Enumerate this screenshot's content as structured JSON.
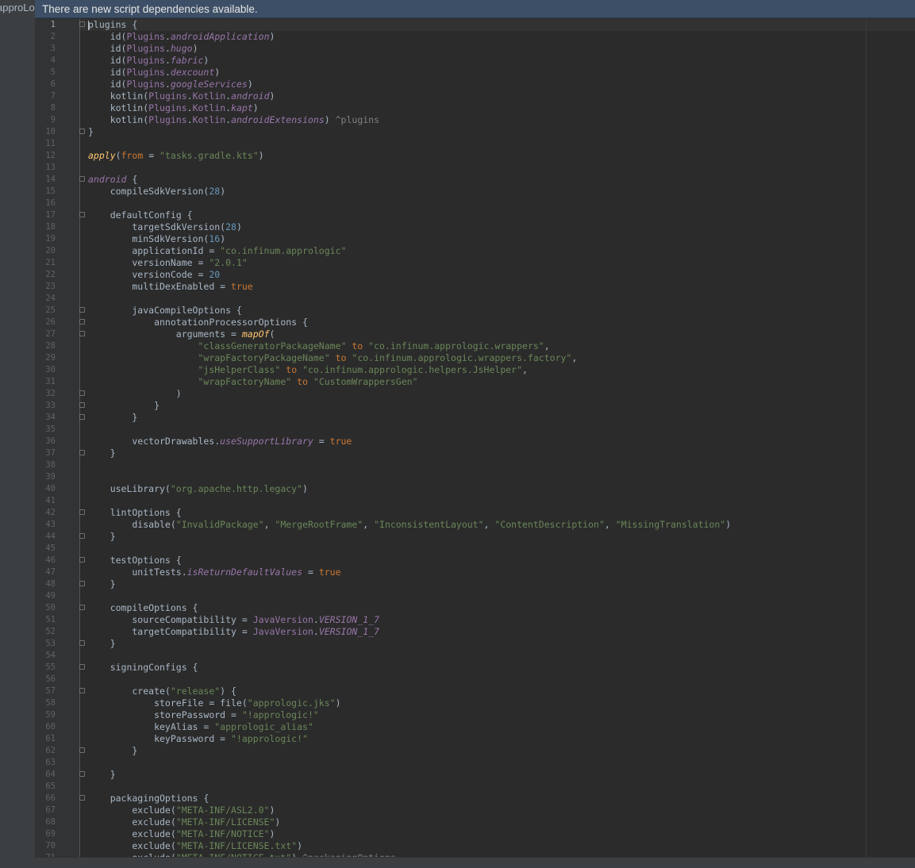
{
  "window": {
    "project_label": "approLogic"
  },
  "banner": {
    "message": "There are new script dependencies available."
  },
  "colors": {
    "keyword": "#cc7832",
    "string": "#6a8759",
    "number": "#6897bb",
    "property": "#9876aa",
    "function": "#ffc66d",
    "text": "#a9b7c6",
    "banner_bg": "#3d4f66"
  },
  "editor": {
    "lines": [
      "plugins {",
      "    id(Plugins.androidApplication)",
      "    id(Plugins.hugo)",
      "    id(Plugins.fabric)",
      "    id(Plugins.dexcount)",
      "    id(Plugins.googleServices)",
      "    kotlin(Plugins.Kotlin.android)",
      "    kotlin(Plugins.Kotlin.kapt)",
      "    kotlin(Plugins.Kotlin.androidExtensions) ^plugins",
      "}",
      "",
      "apply(from = \"tasks.gradle.kts\")",
      "",
      "android {",
      "    compileSdkVersion(28)",
      "",
      "    defaultConfig {",
      "        targetSdkVersion(28)",
      "        minSdkVersion(16)",
      "        applicationId = \"co.infinum.apprologic\"",
      "        versionName = \"2.0.1\"",
      "        versionCode = 20",
      "        multiDexEnabled = true",
      "",
      "        javaCompileOptions {",
      "            annotationProcessorOptions {",
      "                arguments = mapOf(",
      "                    \"classGeneratorPackageName\" to \"co.infinum.apprologic.wrappers\",",
      "                    \"wrapFactoryPackageName\" to \"co.infinum.apprologic.wrappers.factory\",",
      "                    \"jsHelperClass\" to \"co.infinum.apprologic.helpers.JsHelper\",",
      "                    \"wrapFactoryName\" to \"CustomWrappersGen\"",
      "                )",
      "            }",
      "        }",
      "",
      "        vectorDrawables.useSupportLibrary = true",
      "    }",
      "",
      "",
      "    useLibrary(\"org.apache.http.legacy\")",
      "",
      "    lintOptions {",
      "        disable(\"InvalidPackage\", \"MergeRootFrame\", \"InconsistentLayout\", \"ContentDescription\", \"MissingTranslation\")",
      "    }",
      "",
      "    testOptions {",
      "        unitTests.isReturnDefaultValues = true",
      "    }",
      "",
      "    compileOptions {",
      "        sourceCompatibility = JavaVersion.VERSION_1_7",
      "        targetCompatibility = JavaVersion.VERSION_1_7",
      "    }",
      "",
      "    signingConfigs {",
      "",
      "        create(\"release\") {",
      "            storeFile = file(\"apprologic.jks\")",
      "            storePassword = \"!apprologic!\"",
      "            keyAlias = \"apprologic_alias\"",
      "            keyPassword = \"!apprologic!\"",
      "        }",
      "",
      "    }",
      "",
      "    packagingOptions {",
      "        exclude(\"META-INF/ASL2.0\")",
      "        exclude(\"META-INF/LICENSE\")",
      "        exclude(\"META-INF/NOTICE\")",
      "        exclude(\"META-INF/LICENSE.txt\")",
      "        exclude(\"META-INF/NOTICE.txt\") ^packagingOptions"
    ],
    "fold_lines": [
      1,
      10,
      14,
      17,
      25,
      26,
      27,
      32,
      33,
      34,
      37,
      42,
      44,
      46,
      48,
      50,
      53,
      55,
      57,
      62,
      64,
      66
    ],
    "current_line": 1
  }
}
